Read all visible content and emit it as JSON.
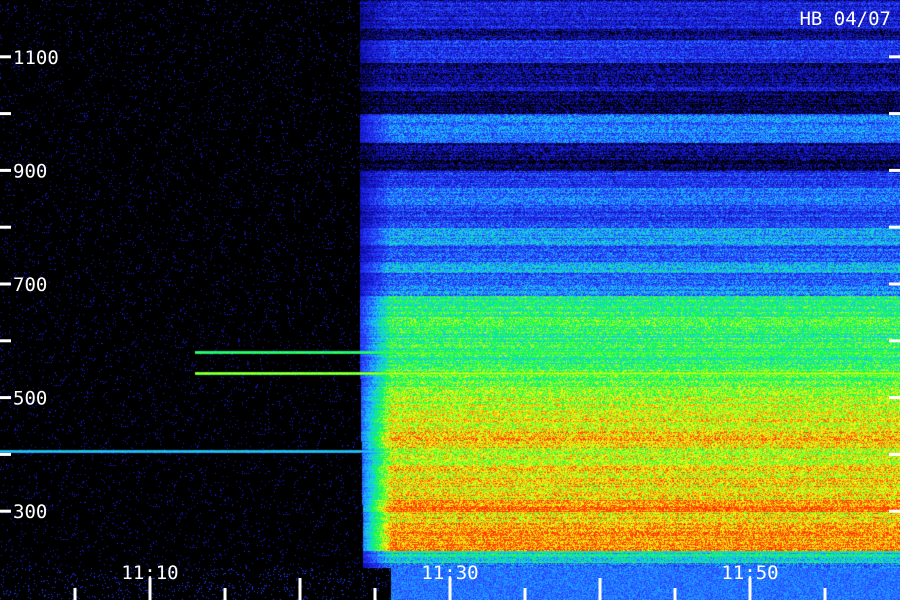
{
  "chart_data": {
    "type": "heatmap",
    "title": "",
    "annotation": "HB 04/07",
    "xlabel": "",
    "ylabel": "",
    "x_tick_labels": [
      "11:10",
      "11:30",
      "11:50"
    ],
    "y_tick_labels": [
      "1100",
      "900",
      "700",
      "500",
      "300"
    ],
    "x_range": [
      "11:00",
      "12:00"
    ],
    "x_major_ticks": [
      "11:10",
      "11:30",
      "11:50"
    ],
    "x_minor_tick_minutes": 5,
    "y_range": [
      200,
      1200
    ],
    "y_major_ticks": [
      1100,
      900,
      700,
      500,
      300
    ],
    "y_minor_ticks": [
      1000,
      800,
      600,
      400
    ],
    "grid": false,
    "colormap": [
      "#000000",
      "#1010c0",
      "#2a40ff",
      "#18c8ff",
      "#10ff40",
      "#ffff10",
      "#ff3000"
    ],
    "onset_time": "11:24",
    "onset_sharp_time": "11:26",
    "bands": [
      {
        "y_min": 1150,
        "y_max": 1200,
        "level": 0.22
      },
      {
        "y_min": 1130,
        "y_max": 1150,
        "level": 0.12
      },
      {
        "y_min": 1090,
        "y_max": 1130,
        "level": 0.28
      },
      {
        "y_min": 1050,
        "y_max": 1090,
        "level": 0.12
      },
      {
        "y_min": 1040,
        "y_max": 1050,
        "level": 0.2
      },
      {
        "y_min": 1000,
        "y_max": 1040,
        "level": 0.06
      },
      {
        "y_min": 950,
        "y_max": 1000,
        "level": 0.4
      },
      {
        "y_min": 920,
        "y_max": 950,
        "level": 0.12
      },
      {
        "y_min": 900,
        "y_max": 920,
        "level": 0.06
      },
      {
        "y_min": 870,
        "y_max": 900,
        "level": 0.28
      },
      {
        "y_min": 840,
        "y_max": 870,
        "level": 0.4
      },
      {
        "y_min": 800,
        "y_max": 840,
        "level": 0.3
      },
      {
        "y_min": 770,
        "y_max": 800,
        "level": 0.45
      },
      {
        "y_min": 740,
        "y_max": 770,
        "level": 0.34
      },
      {
        "y_min": 720,
        "y_max": 740,
        "level": 0.5
      },
      {
        "y_min": 700,
        "y_max": 720,
        "level": 0.36
      },
      {
        "y_min": 680,
        "y_max": 700,
        "level": 0.42
      },
      {
        "y_min": 660,
        "y_max": 680,
        "level": 0.6
      },
      {
        "y_min": 620,
        "y_max": 660,
        "level": 0.65
      },
      {
        "y_min": 560,
        "y_max": 620,
        "level": 0.64
      },
      {
        "y_min": 520,
        "y_max": 560,
        "level": 0.7
      },
      {
        "y_min": 480,
        "y_max": 520,
        "level": 0.78
      },
      {
        "y_min": 440,
        "y_max": 480,
        "level": 0.82
      },
      {
        "y_min": 410,
        "y_max": 440,
        "level": 0.86
      },
      {
        "y_min": 380,
        "y_max": 410,
        "level": 0.8
      },
      {
        "y_min": 350,
        "y_max": 380,
        "level": 0.84
      },
      {
        "y_min": 320,
        "y_max": 350,
        "level": 0.86
      },
      {
        "y_min": 300,
        "y_max": 320,
        "level": 0.95
      },
      {
        "y_min": 280,
        "y_max": 300,
        "level": 0.85
      },
      {
        "y_min": 230,
        "y_max": 280,
        "level": 0.92
      },
      {
        "y_min": 210,
        "y_max": 230,
        "level": 0.55
      },
      {
        "y_min": 200,
        "y_max": 210,
        "level": 0.4
      }
    ],
    "lines": [
      {
        "y": 581,
        "t_start": "11:13",
        "t_end": "12:00",
        "level": 0.7
      },
      {
        "y": 543,
        "t_start": "11:13",
        "t_end": "12:00",
        "level": 0.8
      },
      {
        "y": 406,
        "t_start": "11:00",
        "t_end": "12:00",
        "level": 0.55
      }
    ]
  }
}
